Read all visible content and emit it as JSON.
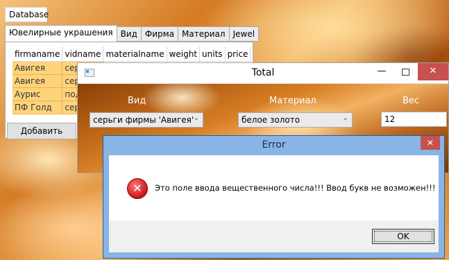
{
  "window": {
    "menu_label": "Database"
  },
  "tabs": [
    {
      "label": "Ювелирные украшения"
    },
    {
      "label": "Вид"
    },
    {
      "label": "Фирма"
    },
    {
      "label": "Материал"
    },
    {
      "label": "Jewel"
    }
  ],
  "grid": {
    "columns": [
      "firmaname",
      "vidname",
      "materialname",
      "weight",
      "units",
      "price"
    ],
    "rows": [
      [
        "Авигея",
        "сер"
      ],
      [
        "Авигея",
        "сер"
      ],
      [
        "Аурис",
        "под"
      ],
      [
        "ПФ Голд",
        "сер"
      ]
    ]
  },
  "add_button": "Добавить",
  "total": {
    "title": "Total",
    "min_glyph": "—",
    "close_glyph": "✕",
    "vid_label": "Вид",
    "material_label": "Материал",
    "ves_label": "Вес",
    "vid_value": "серьги фирмы 'Авигея'",
    "material_value": "белое золото",
    "ves_value": "12",
    "chevron": "⌄"
  },
  "error": {
    "title": "Error",
    "close_glyph": "✕",
    "icon_glyph": "✕",
    "message": "Это поле ввода вещественного числа!!! Ввод букв не возможен!!!",
    "ok_label": "OK"
  }
}
